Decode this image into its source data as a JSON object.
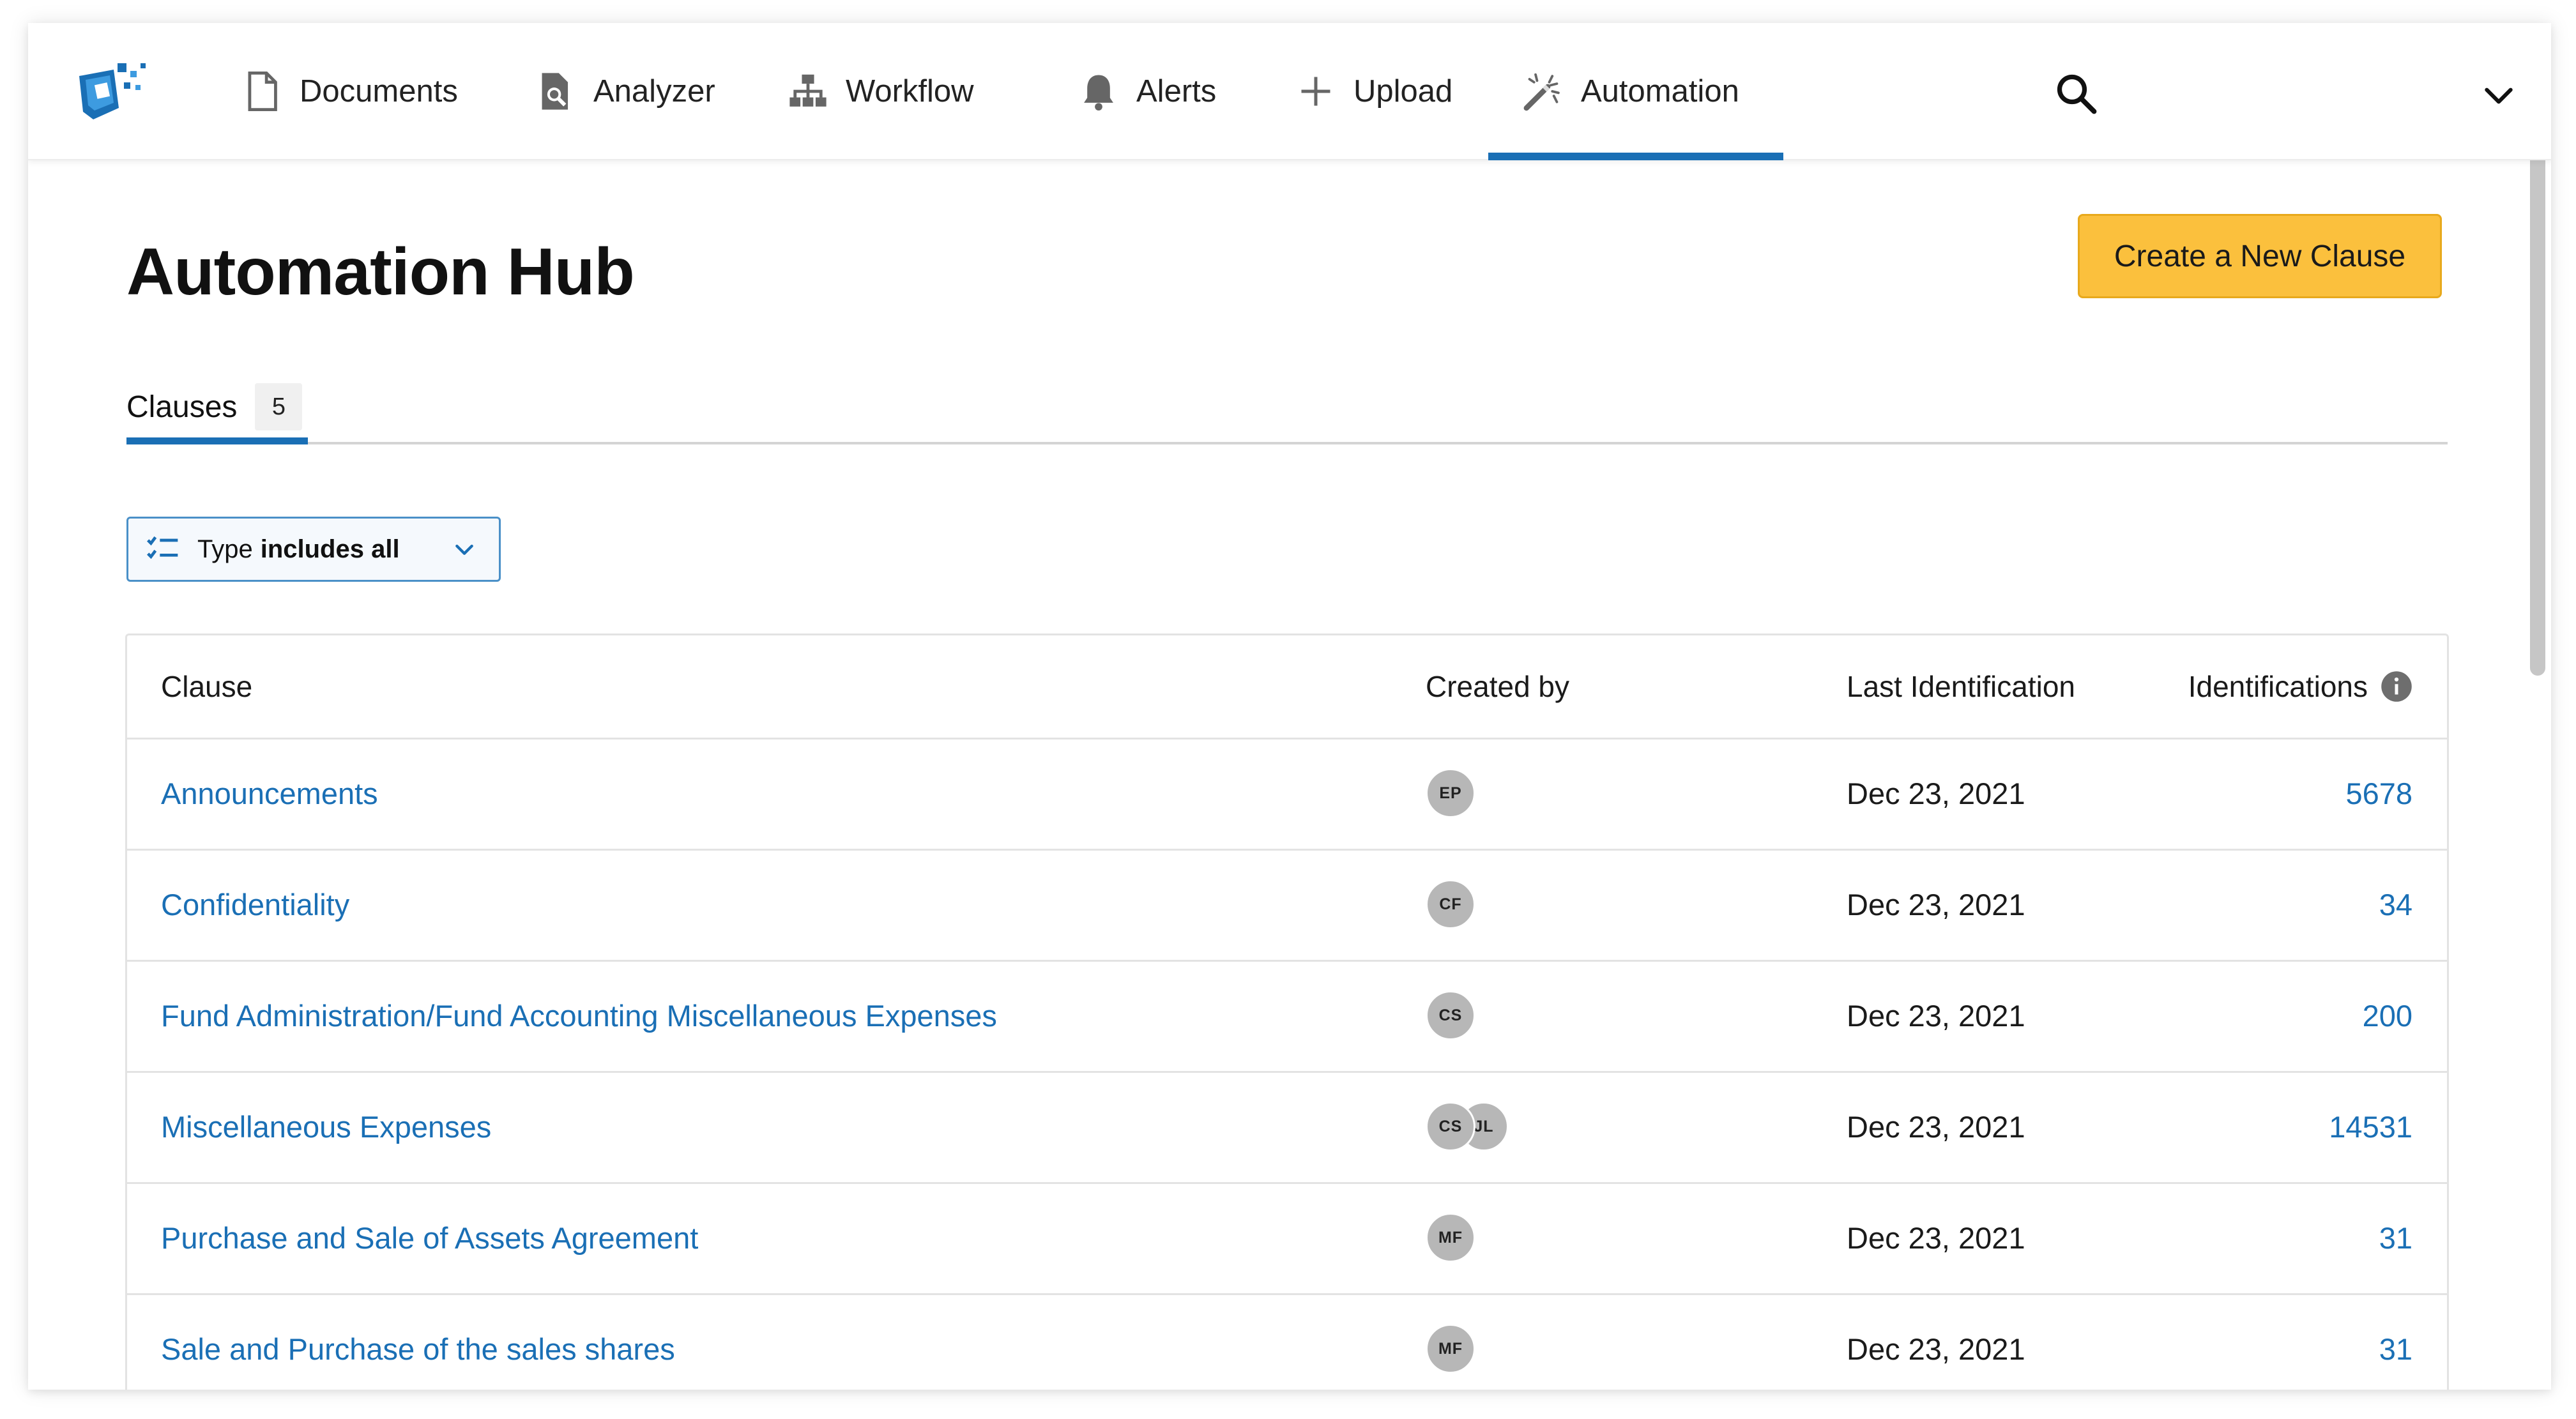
{
  "nav": {
    "items": [
      {
        "label": "Documents",
        "icon": "document-icon"
      },
      {
        "label": "Analyzer",
        "icon": "analyzer-icon"
      },
      {
        "label": "Workflow",
        "icon": "workflow-icon"
      },
      {
        "label": "Alerts",
        "icon": "bell-icon"
      },
      {
        "label": "Upload",
        "icon": "plus-icon"
      },
      {
        "label": "Automation",
        "icon": "magic-wand-icon",
        "active": true
      }
    ]
  },
  "page": {
    "title": "Automation Hub",
    "create_button": "Create a New Clause"
  },
  "tabs": [
    {
      "label": "Clauses",
      "count": "5",
      "active": true
    }
  ],
  "filter": {
    "field": "Type",
    "operator": "includes all"
  },
  "table": {
    "headers": {
      "clause": "Clause",
      "created_by": "Created by",
      "last_identification": "Last Identification",
      "identifications": "Identifications"
    },
    "rows": [
      {
        "clause": "Announcements",
        "creators": [
          "EP"
        ],
        "last": "Dec 23, 2021",
        "count": "5678"
      },
      {
        "clause": "Confidentiality",
        "creators": [
          "CF"
        ],
        "last": "Dec 23, 2021",
        "count": "34"
      },
      {
        "clause": "Fund Administration/Fund Accounting Miscellaneous Expenses",
        "creators": [
          "CS"
        ],
        "last": "Dec 23, 2021",
        "count": "200"
      },
      {
        "clause": "Miscellaneous Expenses",
        "creators": [
          "CS",
          "JL"
        ],
        "last": "Dec 23, 2021",
        "count": "14531"
      },
      {
        "clause": "Purchase and Sale of Assets Agreement",
        "creators": [
          "MF"
        ],
        "last": "Dec 23, 2021",
        "count": "31"
      },
      {
        "clause": "Sale and Purchase of the sales shares",
        "creators": [
          "MF"
        ],
        "last": "Dec 23, 2021",
        "count": "31"
      }
    ]
  },
  "colors": {
    "accent": "#1a6fb5",
    "primary_button": "#fbc03d",
    "avatar": "#b7b7b7"
  }
}
